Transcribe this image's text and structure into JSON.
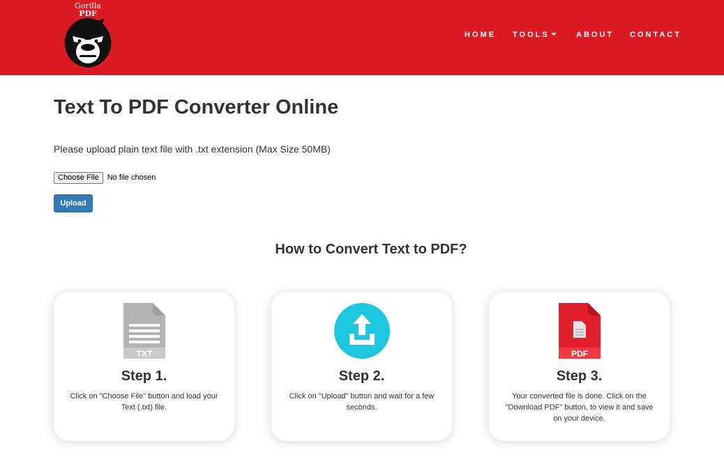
{
  "brand": {
    "line1": "Gorilla",
    "line2": "PDF",
    "logo_icon": "gorilla-head-icon"
  },
  "nav": {
    "items": [
      {
        "label": "HOME"
      },
      {
        "label": "TOOLS"
      },
      {
        "label": "ABOUT"
      },
      {
        "label": "CONTACT"
      }
    ]
  },
  "main": {
    "title": "Text To PDF Converter Online",
    "instructions": "Please upload plain text file with .txt extension (Max Size 50MB)",
    "file_input": {
      "button_label": "Choose File",
      "status": "No file chosen"
    },
    "upload_label": "Upload"
  },
  "howto": {
    "title": "How to Convert Text to PDF?",
    "steps": [
      {
        "title": "Step 1.",
        "text": "Click on \"Choose File\" button and load your Text (.txt) file.",
        "icon": "txt-file-icon",
        "icon_label": "TXT"
      },
      {
        "title": "Step 2.",
        "text": "Click on \"Upload\" button and wait for a few seconds.",
        "icon": "upload-icon"
      },
      {
        "title": "Step 3.",
        "text": "Your converted file is done. Click on the \"Download PDF\" button, to view it and save on your device.",
        "icon": "pdf-file-icon",
        "icon_label": "PDF"
      }
    ]
  },
  "colors": {
    "header": "#dc1a24",
    "primary_button": "#337ab7",
    "upload_icon": "#1ec7e0",
    "txt_icon": "#b3b3b3",
    "pdf_icon": "#e0202b"
  }
}
